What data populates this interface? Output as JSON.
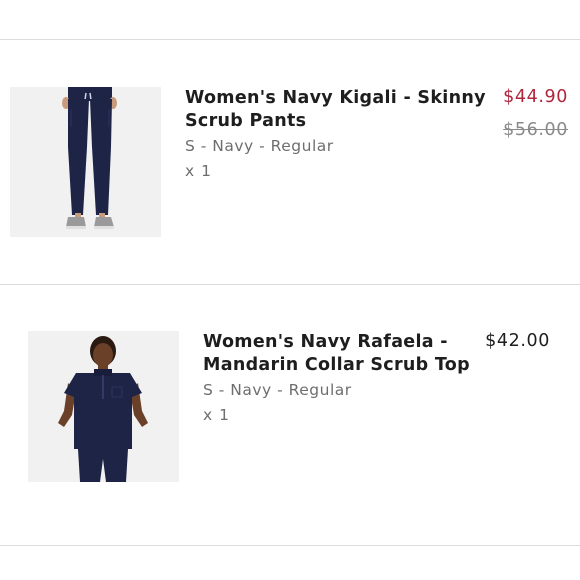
{
  "cart": {
    "items": [
      {
        "name_line1": "Women's Navy Kigali - Skinny",
        "name_line2": "Scrub Pants",
        "variant": "S - Navy - Regular",
        "quantity": "x 1",
        "sale_price": "$44.90",
        "original_price": "$56.00",
        "image": "navy-skinny-scrub-pants-photo"
      },
      {
        "name_line1": "Women's Navy Rafaela -",
        "name_line2": "Mandarin Collar Scrub Top",
        "variant": "S - Navy - Regular",
        "quantity": "x 1",
        "price": "$42.00",
        "image": "navy-mandarin-collar-scrub-top-photo"
      }
    ]
  },
  "colors": {
    "sale_price": "#b0243c",
    "navy_garment": "#1d2446"
  }
}
